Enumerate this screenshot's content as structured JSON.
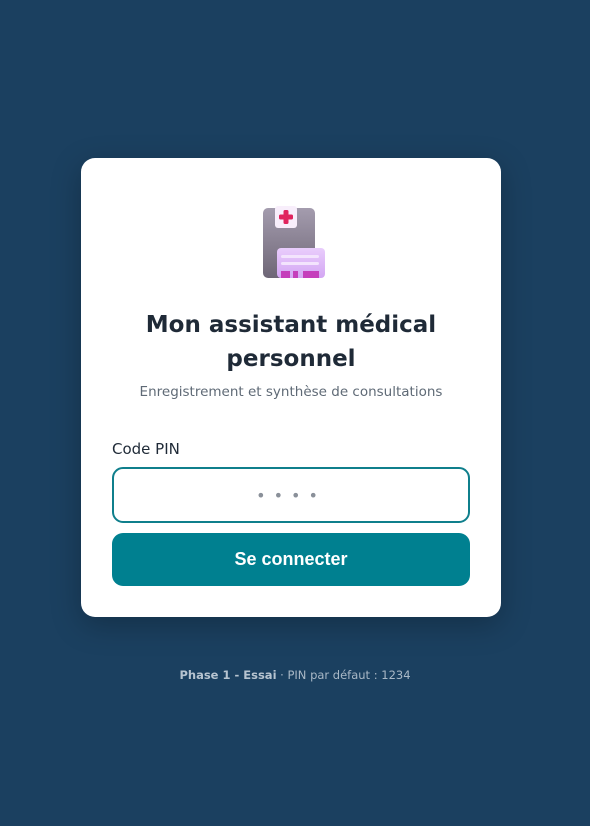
{
  "login_card": {
    "logo_icon": "medical-clipboard-icon",
    "title": "Mon assistant médical personnel",
    "subtitle": "Enregistrement et synthèse de consultations",
    "pin_label": "Code PIN",
    "pin_placeholder": "••••",
    "pin_value": "",
    "submit_label": "Se connecter"
  },
  "footer": {
    "phase": "Phase 1 - Essai",
    "separator": " · ",
    "note": "PIN par défaut : 1234"
  },
  "colors": {
    "background": "#1b4060",
    "card": "#ffffff",
    "accent": "#008090",
    "input_border": "#0f7f8c",
    "title_text": "#1f2a37"
  }
}
